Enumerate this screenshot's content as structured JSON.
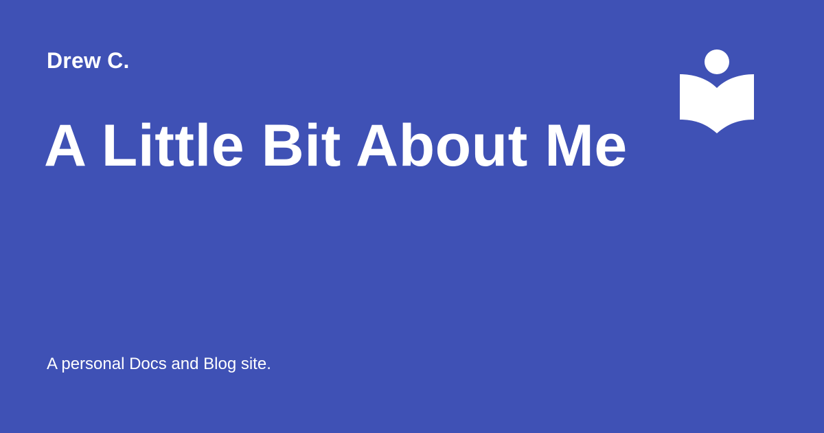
{
  "card": {
    "background_color": "#3f51b5",
    "text_color": "#ffffff",
    "site_name": "Drew C.",
    "title": "A Little Bit About Me",
    "description": "A personal Docs and Blog site.",
    "logo_icon": "book-reader-icon"
  }
}
